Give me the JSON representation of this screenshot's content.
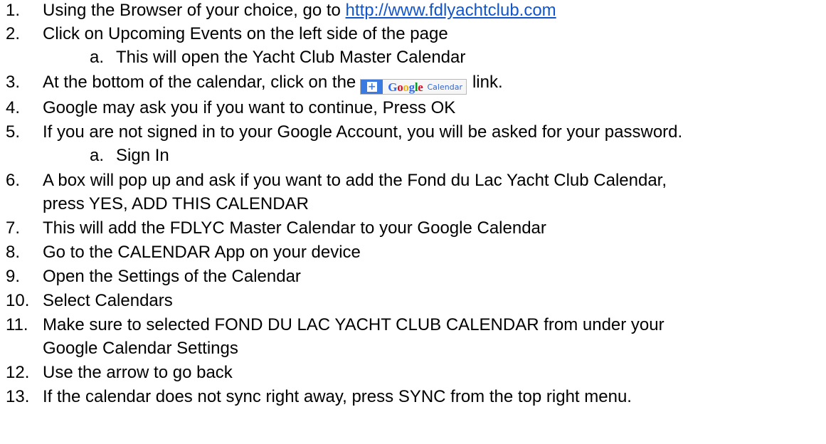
{
  "steps": [
    {
      "num": "1.",
      "before": "Using the Browser of your choice, go to ",
      "link": "http://www.fdlyachtclub.com"
    },
    {
      "num": "2.",
      "text": "Click on Upcoming Events on the left side of the page"
    },
    {
      "num": "a.",
      "text": "This will open the Yacht Club Master Calendar"
    },
    {
      "num": "3.",
      "before": "At the bottom of the calendar, click on the",
      "after": "link."
    },
    {
      "num": "4.",
      "text": "Google may ask you if you want to continue, Press OK"
    },
    {
      "num": "5.",
      "text": "If you are not signed in to your Google Account, you will be asked for your password."
    },
    {
      "num": "a.",
      "text": "Sign In"
    },
    {
      "num": "6.",
      "text": "A box will pop up and ask if you want to add the Fond du Lac Yacht Club Calendar,"
    },
    {
      "text": "press YES, ADD THIS CALENDAR"
    },
    {
      "num": "7.",
      "text": "This will add the FDLYC Master Calendar to your Google Calendar"
    },
    {
      "num": "8.",
      "text": "Go to the CALENDAR App on your device"
    },
    {
      "num": "9.",
      "text": "Open the Settings of the Calendar"
    },
    {
      "num": "10.",
      "text": "Select Calendars"
    },
    {
      "num": "11.",
      "text": "Make sure to selected FOND DU LAC YACHT CLUB CALENDAR from under your"
    },
    {
      "text": "Google Calendar Settings"
    },
    {
      "num": "12.",
      "text": "Use the arrow to go back"
    },
    {
      "num": "13.",
      "text": "If the calendar does not sync right away, press SYNC from the top right menu."
    }
  ],
  "google_button": {
    "plus": "+",
    "google_letters": [
      {
        "char": "G",
        "color": "#3369e8"
      },
      {
        "char": "o",
        "color": "#d50f25"
      },
      {
        "char": "o",
        "color": "#eeb211"
      },
      {
        "char": "g",
        "color": "#3369e8"
      },
      {
        "char": "l",
        "color": "#009925"
      },
      {
        "char": "e",
        "color": "#d50f25"
      }
    ],
    "label": "Calendar"
  },
  "colors": {
    "link": "#1155cc",
    "button_plus_bg": "#3b7be1",
    "text": "#000000"
  }
}
